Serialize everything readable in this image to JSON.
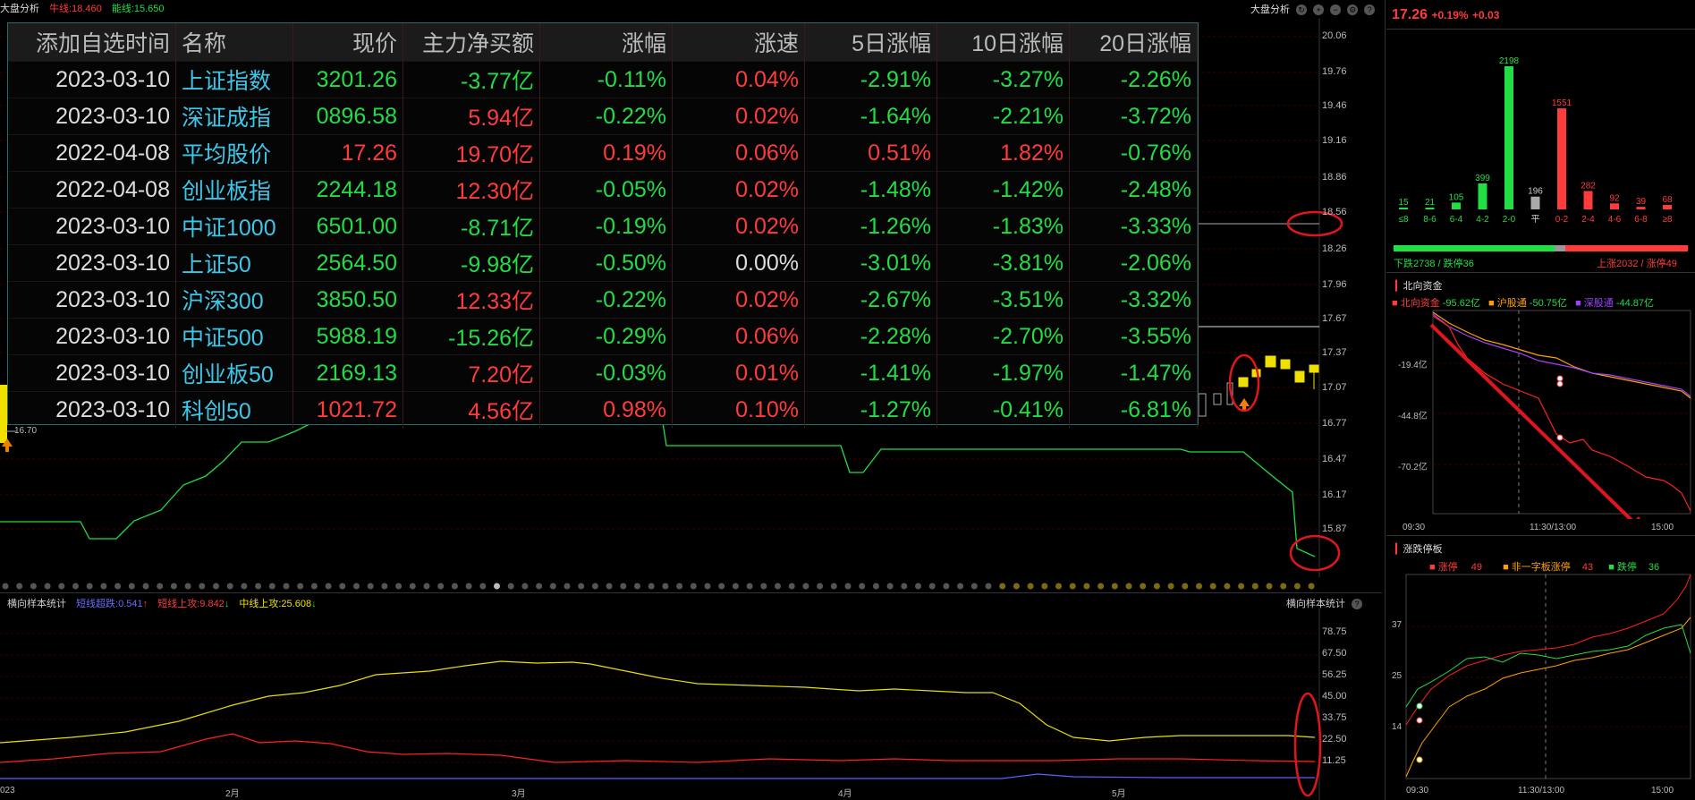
{
  "topbar": {
    "title": "大盘分析",
    "cow_line": "牛线:18.460",
    "energy_line": "能线:15.650",
    "right_label": "大盘分析"
  },
  "main_axis": [
    "20.06",
    "19.76",
    "19.46",
    "19.16",
    "18.86",
    "18.56",
    "18.26",
    "17.96",
    "17.67",
    "17.37",
    "17.07",
    "16.77",
    "16.47",
    "16.17",
    "15.87"
  ],
  "marker_low": "16.70",
  "table": {
    "headers": [
      "添加自选时间",
      "名称",
      "现价",
      "主力净买额",
      "涨幅",
      "涨速",
      "5日涨幅",
      "10日涨幅",
      "20日涨幅"
    ],
    "rows": [
      {
        "date": "2023-03-10",
        "name": "上证指数",
        "price": "3201.26",
        "net": "-3.77亿",
        "chg": "-0.11%",
        "speed": "0.04%",
        "d5": "-2.91%",
        "d10": "-3.27%",
        "d20": "-2.26%"
      },
      {
        "date": "2023-03-10",
        "name": "深证成指",
        "price": "0896.58",
        "net": "5.94亿",
        "chg": "-0.22%",
        "speed": "0.02%",
        "d5": "-1.64%",
        "d10": "-2.21%",
        "d20": "-3.72%"
      },
      {
        "date": "2022-04-08",
        "name": "平均股价",
        "price": "17.26",
        "net": "19.70亿",
        "chg": "0.19%",
        "speed": "0.06%",
        "d5": "0.51%",
        "d10": "1.82%",
        "d20": "-0.76%"
      },
      {
        "date": "2022-04-08",
        "name": "创业板指",
        "price": "2244.18",
        "net": "12.30亿",
        "chg": "-0.05%",
        "speed": "0.02%",
        "d5": "-1.48%",
        "d10": "-1.42%",
        "d20": "-2.48%"
      },
      {
        "date": "2023-03-10",
        "name": "中证1000",
        "price": "6501.00",
        "net": "-8.71亿",
        "chg": "-0.19%",
        "speed": "0.02%",
        "d5": "-1.26%",
        "d10": "-1.83%",
        "d20": "-3.33%"
      },
      {
        "date": "2023-03-10",
        "name": "上证50",
        "price": "2564.50",
        "net": "-9.98亿",
        "chg": "-0.50%",
        "speed": "0.00%",
        "d5": "-3.01%",
        "d10": "-3.81%",
        "d20": "-2.06%"
      },
      {
        "date": "2023-03-10",
        "name": "沪深300",
        "price": "3850.50",
        "net": "12.33亿",
        "chg": "-0.22%",
        "speed": "0.02%",
        "d5": "-2.67%",
        "d10": "-3.51%",
        "d20": "-3.32%"
      },
      {
        "date": "2023-03-10",
        "name": "中证500",
        "price": "5988.19",
        "net": "-15.26亿",
        "chg": "-0.29%",
        "speed": "0.06%",
        "d5": "-2.28%",
        "d10": "-2.70%",
        "d20": "-3.55%"
      },
      {
        "date": "2023-03-10",
        "name": "创业板50",
        "price": "2169.13",
        "net": "7.20亿",
        "chg": "-0.03%",
        "speed": "0.01%",
        "d5": "-1.41%",
        "d10": "-1.97%",
        "d20": "-1.47%"
      },
      {
        "date": "2023-03-10",
        "name": "科创50",
        "price": "1021.72",
        "net": "4.56亿",
        "chg": "0.98%",
        "speed": "0.10%",
        "d5": "-1.27%",
        "d10": "-0.41%",
        "d20": "-6.81%"
      }
    ]
  },
  "lower": {
    "title": "横向样本统计",
    "l1": "短线超跌:0.541",
    "l2": "短线上攻:9.842",
    "l3": "中线上攻:25.608",
    "right_title": "横向样本统计",
    "axis": [
      "78.75",
      "67.50",
      "56.25",
      "45.00",
      "33.75",
      "22.50",
      "11.25"
    ],
    "months": [
      "023",
      "2月",
      "3月",
      "4月",
      "5月"
    ]
  },
  "right": {
    "price": "17.26",
    "pct": "+0.19%",
    "delta": "+0.03",
    "dist_labels": [
      "≤8",
      "8-6",
      "6-4",
      "4-2",
      "2-0",
      "平",
      "0-2",
      "2-4",
      "4-6",
      "6-8",
      "≥8"
    ],
    "dist_values": [
      "15",
      "21",
      "105",
      "399",
      "2198",
      "196",
      "1551",
      "282",
      "92",
      "39",
      "68"
    ],
    "down_text": "下跌2738 / 跌停36",
    "up_text": "上涨2032 / 涨停49",
    "north": {
      "title": "北向资金",
      "l1": "北向资金",
      "v1": "-95.62亿",
      "l2": "沪股通",
      "v2": "-50.75亿",
      "l3": "深股通",
      "v3": "-44.87亿",
      "axis": [
        "-19.4亿",
        "-44.8亿",
        "-70.2亿"
      ],
      "times": [
        "09:30",
        "11:30/13:00",
        "15:00"
      ]
    },
    "limit": {
      "title": "涨跌停板",
      "l1": "涨停",
      "v1": "49",
      "l2": "非一字板涨停",
      "v2": "43",
      "l3": "跌停",
      "v3": "36",
      "axis": [
        "37",
        "25",
        "14"
      ],
      "times": [
        "09:30",
        "11:30/13:00",
        "15:00"
      ]
    }
  },
  "colors": {
    "up": "#ff3b3b",
    "down": "#22dd44",
    "yellow": "#f0e000",
    "annotation": "#e0161d"
  }
}
